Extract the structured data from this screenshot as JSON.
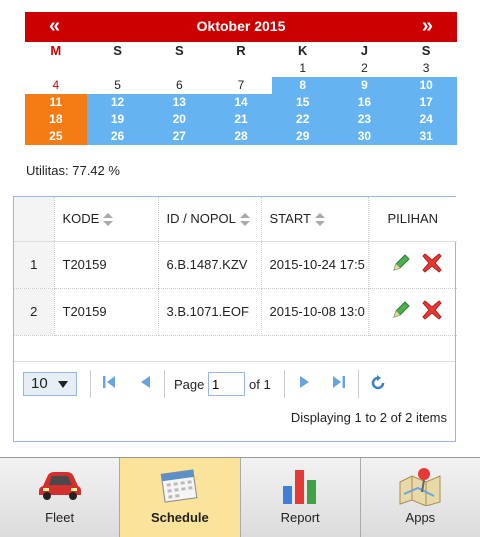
{
  "calendar": {
    "title": "Oktober 2015",
    "prev": "«",
    "next": "»",
    "weekdays": [
      "M",
      "S",
      "S",
      "R",
      "K",
      "J",
      "S"
    ],
    "rows": [
      [
        "",
        "",
        "",
        "",
        "1",
        "2",
        "3"
      ],
      [
        "4",
        "5",
        "6",
        "7",
        "8",
        "9",
        "10"
      ],
      [
        "11",
        "12",
        "13",
        "14",
        "15",
        "16",
        "17"
      ],
      [
        "18",
        "19",
        "20",
        "21",
        "22",
        "23",
        "24"
      ],
      [
        "25",
        "26",
        "27",
        "28",
        "29",
        "30",
        "31"
      ]
    ],
    "colors": {
      "header": "#cc0000",
      "booked": "#66b3f2",
      "sunday_booked": "#f57c14"
    }
  },
  "utilitas": "Utilitas: 77.42 %",
  "table": {
    "columns": [
      "KODE",
      "ID / NOPOL",
      "START",
      "PILIHAN"
    ],
    "rows": [
      {
        "no": "1",
        "kode": "T20159",
        "nopol": "6.B.1487.KZV",
        "start": "2015-10-24 17:5"
      },
      {
        "no": "2",
        "kode": "T20159",
        "nopol": "3.B.1071.EOF",
        "start": "2015-10-08 13:0"
      }
    ]
  },
  "pager": {
    "page_size": "10",
    "page_label": "Page",
    "page_value": "1",
    "of_label": "of 1",
    "display": "Displaying 1 to 2 of 2 items"
  },
  "nav": {
    "items": [
      {
        "label": "Fleet",
        "icon": "car-icon"
      },
      {
        "label": "Schedule",
        "icon": "calendar-icon",
        "active": true
      },
      {
        "label": "Report",
        "icon": "bar-chart-icon"
      },
      {
        "label": "Apps",
        "icon": "map-pin-icon"
      }
    ]
  }
}
